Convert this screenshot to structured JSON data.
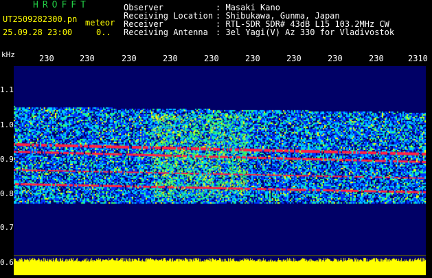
{
  "header": {
    "title": "HROFFT",
    "filename": "UT2509282300.pn",
    "meteor_label": "meteor",
    "datetime": "25.09.28 23:00",
    "count": "0.."
  },
  "info": {
    "observer_label": "Observer",
    "observer_value": ": Masaki Kano",
    "location_label": "Receiving Location",
    "location_value": ": Shibukawa, Gunma, Japan",
    "receiver_label": "Receiver",
    "receiver_value": ": RTL-SDR SDR# 43dB L15 103.2MHz CW",
    "antenna_label": "Receiving Antenna",
    "antenna_value": ": 3el Yagi(V) Az 330 for Vladivostok"
  },
  "axes": {
    "y_unit": "kHz",
    "y_ticks": [
      "1.1",
      "1.0",
      "0.9",
      "0.8",
      "0.7",
      "0.6"
    ],
    "x_ticks": [
      "230",
      "230",
      "230",
      "230",
      "230",
      "230",
      "230",
      "230",
      "230",
      "230",
      "2310"
    ]
  },
  "colors": {
    "background": "#000000",
    "spectro_bg": "#000066",
    "noise_blue": "#0033ff",
    "noise_cyan": "#00ccff",
    "noise_green": "#33ff66",
    "noise_yellow": "#ffff00",
    "signal_red": "#ff2244",
    "title_green": "#22cc44",
    "label_yellow": "#ffff00"
  }
}
